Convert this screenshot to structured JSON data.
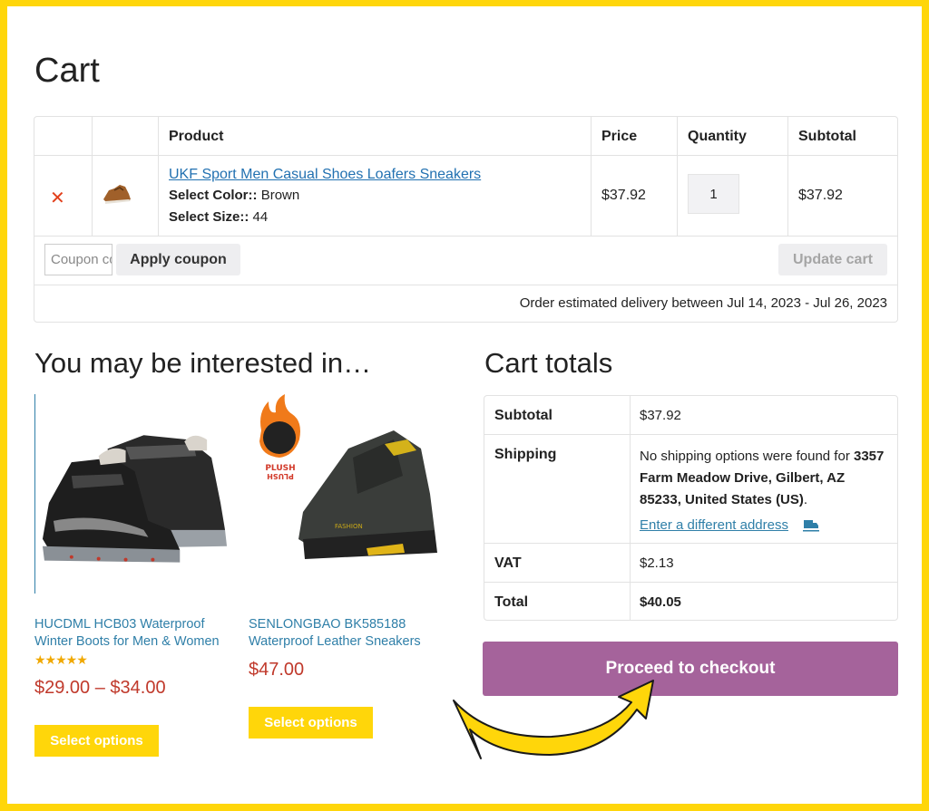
{
  "page": {
    "title": "Cart"
  },
  "cart_table": {
    "headers": {
      "product": "Product",
      "price": "Price",
      "quantity": "Quantity",
      "subtotal": "Subtotal"
    },
    "items": [
      {
        "name": "UKF Sport Men Casual Shoes Loafers Sneakers",
        "color_label": "Select Color::",
        "color_value": "Brown",
        "size_label": "Select Size::",
        "size_value": "44",
        "price": "$37.92",
        "quantity": "1",
        "subtotal": "$37.92",
        "remove_icon": "close-icon"
      }
    ],
    "coupon_placeholder": "Coupon code",
    "apply_coupon_label": "Apply coupon",
    "update_cart_label": "Update cart",
    "delivery_text": "Order estimated delivery between Jul 14, 2023 - Jul 26, 2023"
  },
  "interested": {
    "title": "You may be interested in…",
    "products": [
      {
        "name": "HUCDML HCB03 Waterproof Winter Boots for Men & Women",
        "rating": 5,
        "stars": "★★★★★",
        "price": "$29.00 – $34.00",
        "button": "Select options"
      },
      {
        "name": "SENLONGBAO BK585188 Waterproof Leather Sneakers",
        "badge": "PLUSH",
        "badge_flipped": "PLUSH",
        "price": "$47.00",
        "button": "Select options"
      }
    ]
  },
  "totals": {
    "title": "Cart totals",
    "subtotal_label": "Subtotal",
    "subtotal_value": "$37.92",
    "shipping_label": "Shipping",
    "shipping_text": "No shipping options were found for",
    "shipping_address": "3357 Farm Meadow Drive, Gilbert, AZ 85233, United States (US)",
    "shipping_period": ".",
    "different_address_link": "Enter a different address",
    "vat_label": "VAT",
    "vat_value": "$2.13",
    "total_label": "Total",
    "total_value": "$40.05",
    "checkout_button": "Proceed to checkout"
  },
  "colors": {
    "frame_border": "#ffd60a",
    "link": "#2f7fa8",
    "price_red": "#c0392b",
    "checkout_purple": "#a5639b",
    "select_yellow": "#ffd60a",
    "remove_red": "#e2401c"
  }
}
